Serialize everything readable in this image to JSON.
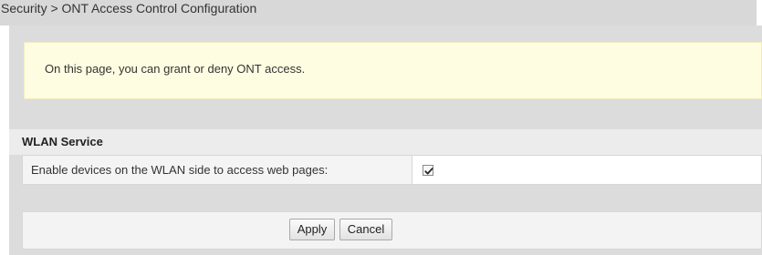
{
  "breadcrumb": "Security > ONT Access Control Configuration",
  "info": {
    "text": "On this page, you can grant or deny ONT access."
  },
  "wlan_section": {
    "title": "WLAN Service",
    "enable_label": "Enable devices on the WLAN side to access web pages:",
    "enable_checked": true
  },
  "buttons": {
    "apply": "Apply",
    "cancel": "Cancel"
  },
  "colors": {
    "info_background": "#fffde1",
    "panel_background": "#dcdcdc"
  }
}
